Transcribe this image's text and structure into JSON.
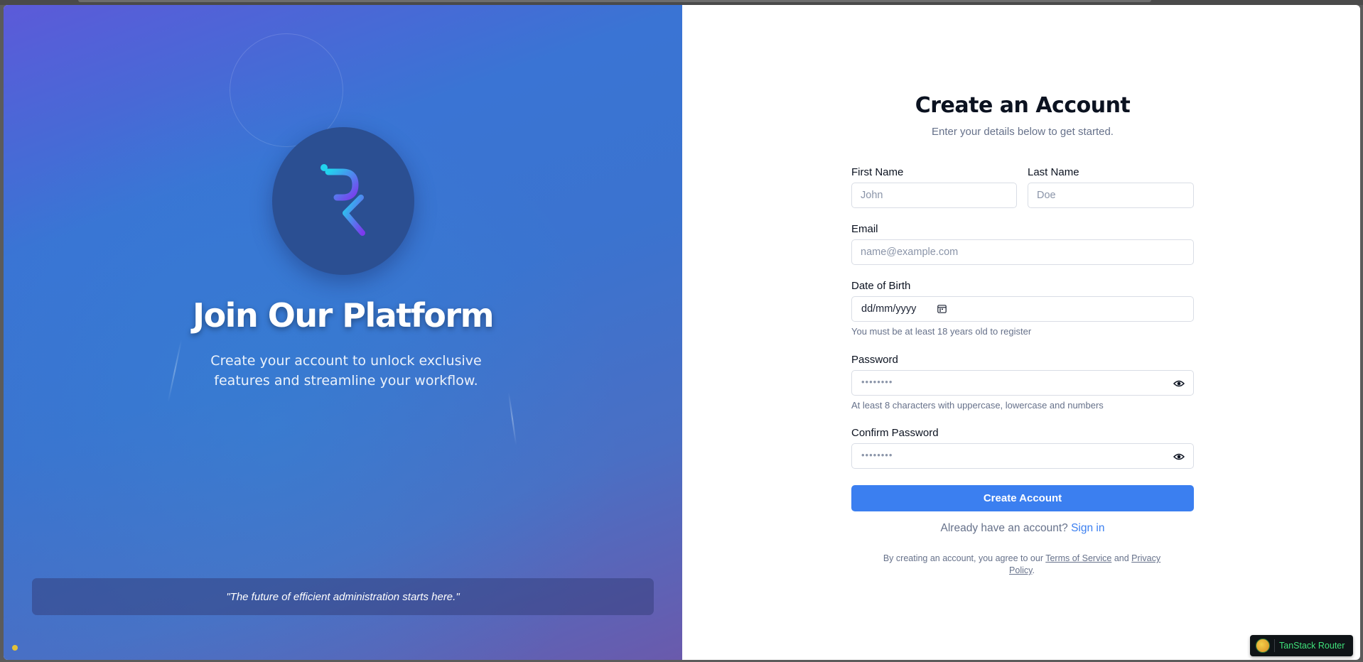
{
  "left_panel": {
    "title": "Join Our Platform",
    "subtitle": "Create your account to unlock exclusive features and streamline your workflow.",
    "quote": "\"The future of efficient administration starts here.\""
  },
  "form": {
    "title": "Create an Account",
    "subtitle": "Enter your details below to get started.",
    "first_name": {
      "label": "First Name",
      "placeholder": "John"
    },
    "last_name": {
      "label": "Last Name",
      "placeholder": "Doe"
    },
    "email": {
      "label": "Email",
      "placeholder": "name@example.com"
    },
    "dob": {
      "label": "Date of Birth",
      "value": "dd/mm/yyyy",
      "hint": "You must be at least 18 years old to register"
    },
    "password": {
      "label": "Password",
      "mask": "••••••••",
      "hint": "At least 8 characters with uppercase, lowercase and numbers"
    },
    "confirm_password": {
      "label": "Confirm Password",
      "mask": "••••••••"
    },
    "submit_label": "Create Account",
    "signin_prompt": "Already have an account?",
    "signin_link": "Sign in",
    "terms_prefix": "By creating an account, you agree to our",
    "terms_link": "Terms of Service",
    "terms_and": "and",
    "privacy_link": "Privacy Policy",
    "terms_suffix": "."
  },
  "devtools": {
    "label": "TanStack Router"
  },
  "colors": {
    "accent": "#3b7ff0",
    "logo_circle": "#2b4f92"
  },
  "icons": [
    "logo-icon",
    "calendar-icon",
    "eye-icon",
    "tanstack-logo-icon"
  ]
}
